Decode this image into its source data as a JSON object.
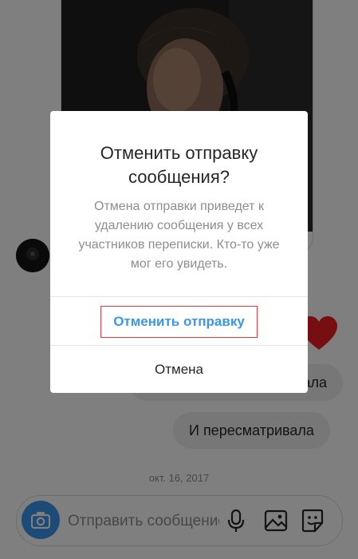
{
  "chat": {
    "messages": [
      "Я пересматривала",
      "И пересматривала"
    ],
    "date": "окт. 16, 2017"
  },
  "composer": {
    "placeholder": "Отправить сообщение..."
  },
  "dialog": {
    "title": "Отменить отправку сообщения?",
    "message": "Отмена отправки приведет к удалению сообщения у всех участников переписки. Кто-то уже мог его увидеть.",
    "primary_label": "Отменить отправку",
    "cancel_label": "Отмена"
  },
  "colors": {
    "accent": "#3897f0",
    "heart": "#ed1c24",
    "highlight": "#e0393e"
  },
  "icons": [
    "camera-icon",
    "microphone-icon",
    "gallery-icon",
    "sticker-icon",
    "heart-icon"
  ]
}
